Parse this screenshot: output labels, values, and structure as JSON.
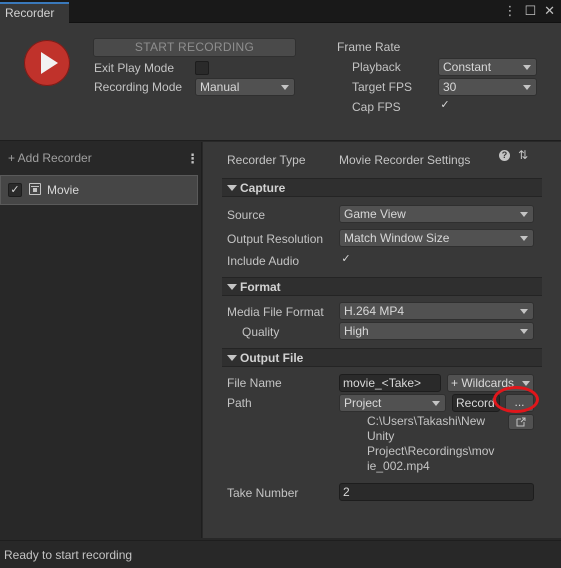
{
  "window": {
    "tab_title": "Recorder"
  },
  "top": {
    "start_label": "START RECORDING",
    "exit_play_mode_label": "Exit Play Mode",
    "recording_mode_label": "Recording Mode",
    "recording_mode_value": "Manual",
    "frame_rate_label": "Frame Rate",
    "playback_label": "Playback",
    "playback_value": "Constant",
    "target_fps_label": "Target FPS",
    "target_fps_value": "30",
    "cap_fps_label": "Cap FPS",
    "cap_fps_check": "✓"
  },
  "list": {
    "add_recorder": "+ Add Recorder",
    "kebab": "⋮",
    "items": [
      {
        "label": "Movie",
        "checked": "✓"
      }
    ]
  },
  "settings": {
    "recorder_type_label": "Recorder Type",
    "recorder_type_value": "Movie Recorder Settings",
    "help_glyph": "?",
    "preset_glyph": "⇅",
    "capture": {
      "header": "Capture",
      "source_label": "Source",
      "source_value": "Game View",
      "output_resolution_label": "Output Resolution",
      "output_resolution_value": "Match Window Size",
      "include_audio_label": "Include Audio",
      "include_audio_check": "✓"
    },
    "format": {
      "header": "Format",
      "media_file_format_label": "Media File Format",
      "media_file_format_value": "H.264 MP4",
      "quality_label": "Quality",
      "quality_value": "High"
    },
    "output_file": {
      "header": "Output File",
      "file_name_label": "File Name",
      "file_name_value": "movie_<Take>",
      "wildcards_label": "+ Wildcards",
      "path_label": "Path",
      "path_root_value": "Project",
      "path_folder_value": "Record",
      "browse_label": "...",
      "full_path_lines": [
        "C:\\Users\\Takashi\\New",
        "Unity",
        "Project\\Recordings\\mov",
        "ie_002.mp4"
      ],
      "take_number_label": "Take Number",
      "take_number_value": "2"
    }
  },
  "status": {
    "text": "Ready to start recording"
  },
  "colors": {
    "record_red": "#c0322b",
    "annotation_red": "#e0161b",
    "accent_blue": "#3a79bb"
  }
}
